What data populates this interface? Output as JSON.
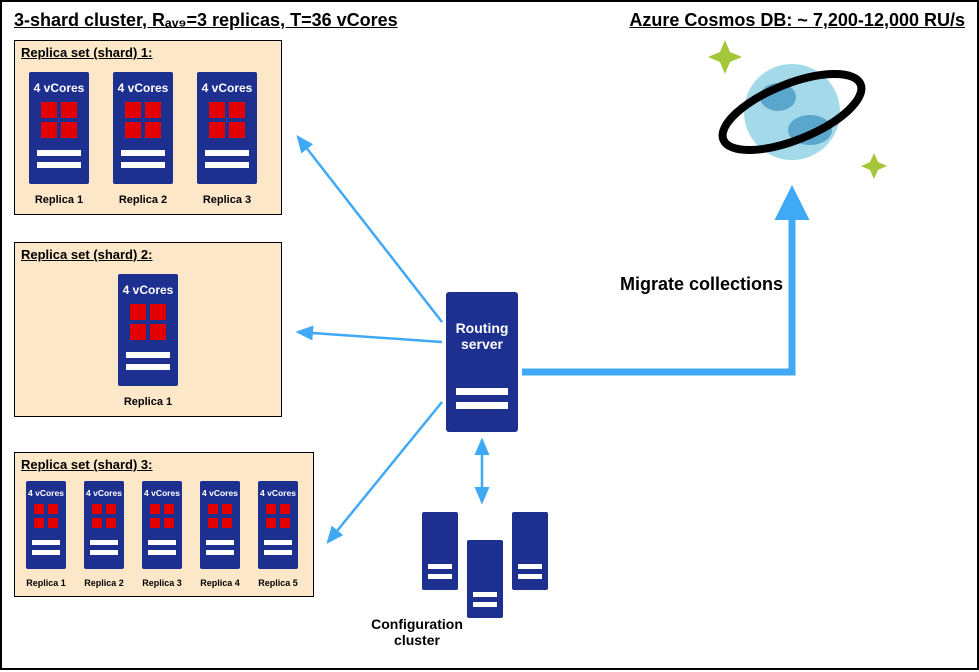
{
  "title_left": "3-shard cluster, Rₐᵥ₉=3 replicas, T=36 vCores",
  "title_right": "Azure Cosmos DB: ~ 7,200-12,000 RU/s",
  "shards": {
    "s1": {
      "label": "Replica set (shard) 1:",
      "vcores": "4 vCores",
      "replicas": [
        "Replica 1",
        "Replica 2",
        "Replica 3"
      ]
    },
    "s2": {
      "label": "Replica set (shard) 2:",
      "vcores": "4 vCores",
      "replicas": [
        "Replica 1"
      ]
    },
    "s3": {
      "label": "Replica set (shard) 3:",
      "vcores": "4 vCores",
      "replicas": [
        "Replica 1",
        "Replica 2",
        "Replica 3",
        "Replica 4",
        "Replica 5"
      ]
    }
  },
  "routing_server": "Routing server",
  "migrate_label": "Migrate collections",
  "config_cluster": "Configuration cluster",
  "colors": {
    "server_blue": "#1d2f8f",
    "arrow_blue": "#3fa9f5",
    "red": "#e30000",
    "shard_bg": "#fce8c8",
    "planet_light": "#a3d9e8",
    "planet_dark": "#5aa6cc",
    "sparkle": "#a4c639"
  }
}
